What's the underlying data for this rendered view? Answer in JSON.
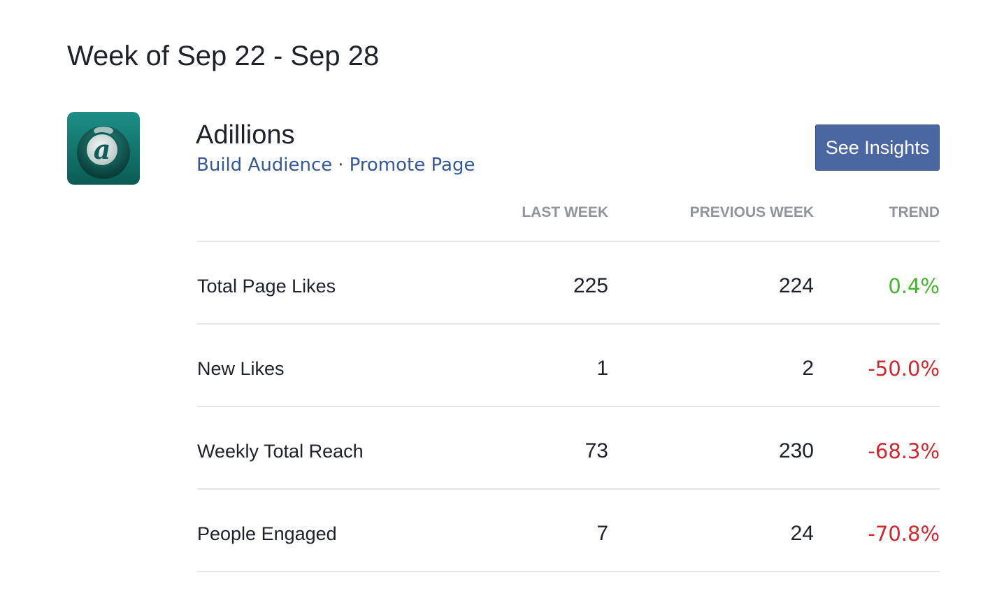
{
  "header": {
    "week_title": "Week of Sep 22 - Sep 28"
  },
  "page": {
    "name": "Adillions",
    "logo_letter": "a",
    "logo_icon": "adillions-logo-icon",
    "links": {
      "build_audience": "Build Audience",
      "separator": "·",
      "promote_page": "Promote Page"
    },
    "insights_button": "See Insights"
  },
  "table": {
    "columns": {
      "last_week": "LAST WEEK",
      "previous_week": "PREVIOUS WEEK",
      "trend": "TREND"
    },
    "rows": [
      {
        "metric": "Total Page Likes",
        "last_week": "225",
        "previous_week": "224",
        "trend": "0.4%",
        "direction": "up"
      },
      {
        "metric": "New Likes",
        "last_week": "1",
        "previous_week": "2",
        "trend": "-50.0%",
        "direction": "down"
      },
      {
        "metric": "Weekly Total Reach",
        "last_week": "73",
        "previous_week": "230",
        "trend": "-68.3%",
        "direction": "down"
      },
      {
        "metric": "People Engaged",
        "last_week": "7",
        "previous_week": "24",
        "trend": "-70.8%",
        "direction": "down"
      }
    ]
  },
  "colors": {
    "link": "#365899",
    "button": "#4b67a1",
    "trend_up": "#42b72a",
    "trend_down": "#d0262d",
    "header_text": "#90949c",
    "divider": "#e5e6e9"
  }
}
